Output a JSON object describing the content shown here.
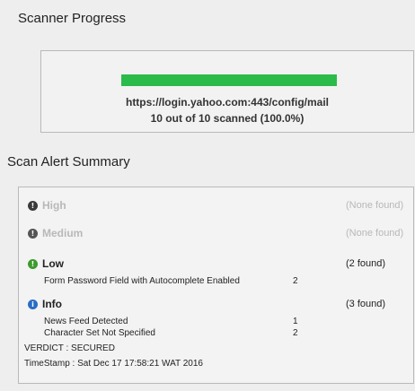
{
  "scanner_progress": {
    "title": "Scanner Progress",
    "url": "https://login.yahoo.com:443/config/mail",
    "count_text": "10 out of 10 scanned (100.0%)",
    "progress_fraction": 1.0,
    "bar_color": "#2bbb4a"
  },
  "summary": {
    "title": "Scan Alert Summary",
    "high": {
      "label": "High",
      "count": "(None found)",
      "icon": "alert-icon",
      "color": "#9a9a9a"
    },
    "medium": {
      "label": "Medium",
      "count": "(None found)",
      "icon": "alert-icon",
      "color": "#9a9a9a"
    },
    "low": {
      "label": "Low",
      "count": "(2 found)",
      "icon": "alert-icon",
      "color": "#3d9a2e",
      "items": [
        {
          "name": "Form Password Field with Autocomplete Enabled",
          "num": "2"
        }
      ]
    },
    "info": {
      "label": "Info",
      "count": "(3 found)",
      "icon": "info-icon",
      "color": "#2a6cc4",
      "items": [
        {
          "name": "News Feed Detected",
          "num": "1"
        },
        {
          "name": "Character Set Not Specified",
          "num": "2"
        }
      ]
    },
    "verdict": "VERDICT : SECURED",
    "timestamp": "TimeStamp : Sat Dec 17 17:58:21 WAT 2016"
  }
}
